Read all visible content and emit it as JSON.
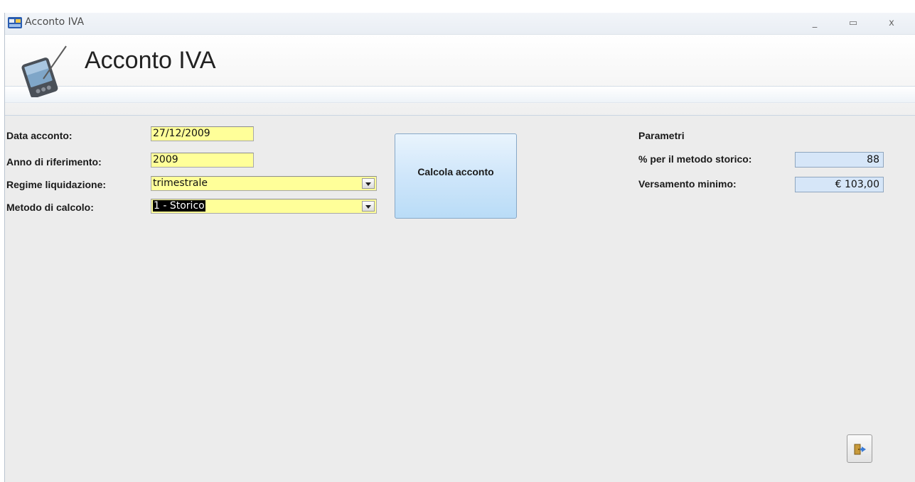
{
  "window": {
    "title": "Acconto IVA",
    "minimize": "_",
    "maximize": "▭",
    "close": "x"
  },
  "header": {
    "title": "Acconto IVA"
  },
  "form": {
    "data_acconto_label": "Data acconto:",
    "data_acconto_value": "27/12/2009",
    "anno_label": "Anno di riferimento:",
    "anno_value": "2009",
    "regime_label": "Regime liquidazione:",
    "regime_value": "trimestrale",
    "metodo_label": "Metodo di calcolo:",
    "metodo_value": "1 - Storico"
  },
  "actions": {
    "calcola_label": "Calcola acconto"
  },
  "parametri": {
    "heading": "Parametri",
    "percent_label": "% per il metodo storico:",
    "percent_value": "88",
    "versamento_label": "Versamento minimo:",
    "versamento_value": "€ 103,00"
  },
  "icons": [
    "app-icon",
    "pda-stylus-icon",
    "dropdown-arrow-icon",
    "exit-door-icon"
  ]
}
